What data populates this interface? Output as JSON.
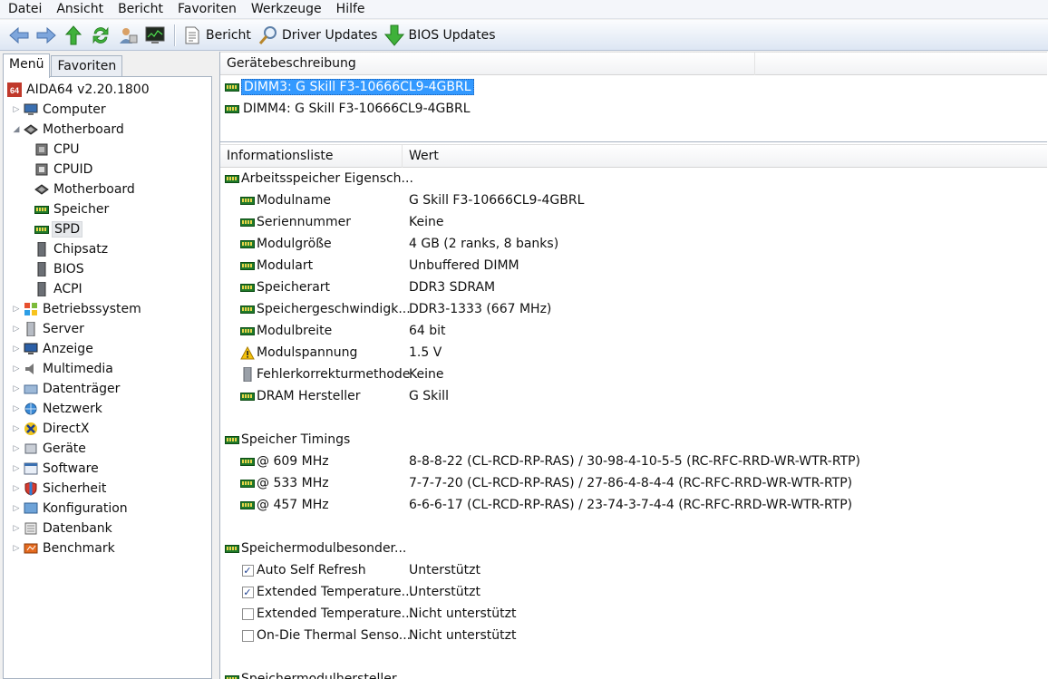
{
  "menu": [
    "Datei",
    "Ansicht",
    "Bericht",
    "Favoriten",
    "Werkzeuge",
    "Hilfe"
  ],
  "toolbar": {
    "report_label": "Bericht",
    "driver_updates_label": "Driver Updates",
    "bios_updates_label": "BIOS Updates"
  },
  "left": {
    "tab_menu": "Menü",
    "tab_favorites": "Favoriten",
    "root": "AIDA64 v2.20.1800",
    "tree": [
      {
        "label": "Computer",
        "level": 1,
        "expander": "collapsed",
        "icon": "computer-icon"
      },
      {
        "label": "Motherboard",
        "level": 1,
        "expander": "expanded",
        "icon": "motherboard-icon"
      },
      {
        "label": "CPU",
        "level": 2,
        "icon": "cpu-icon"
      },
      {
        "label": "CPUID",
        "level": 2,
        "icon": "cpuid-icon"
      },
      {
        "label": "Motherboard",
        "level": 2,
        "icon": "motherboard-icon"
      },
      {
        "label": "Speicher",
        "level": 2,
        "icon": "memory-icon"
      },
      {
        "label": "SPD",
        "level": 2,
        "icon": "spd-icon",
        "selected": true
      },
      {
        "label": "Chipsatz",
        "level": 2,
        "icon": "chipset-icon"
      },
      {
        "label": "BIOS",
        "level": 2,
        "icon": "bios-icon"
      },
      {
        "label": "ACPI",
        "level": 2,
        "icon": "acpi-icon"
      },
      {
        "label": "Betriebssystem",
        "level": 1,
        "expander": "collapsed",
        "icon": "windows-icon"
      },
      {
        "label": "Server",
        "level": 1,
        "expander": "collapsed",
        "icon": "server-icon"
      },
      {
        "label": "Anzeige",
        "level": 1,
        "expander": "collapsed",
        "icon": "display-icon"
      },
      {
        "label": "Multimedia",
        "level": 1,
        "expander": "collapsed",
        "icon": "speaker-icon"
      },
      {
        "label": "Datenträger",
        "level": 1,
        "expander": "collapsed",
        "icon": "storage-icon"
      },
      {
        "label": "Netzwerk",
        "level": 1,
        "expander": "collapsed",
        "icon": "network-icon"
      },
      {
        "label": "DirectX",
        "level": 1,
        "expander": "collapsed",
        "icon": "directx-icon"
      },
      {
        "label": "Geräte",
        "level": 1,
        "expander": "collapsed",
        "icon": "devices-icon"
      },
      {
        "label": "Software",
        "level": 1,
        "expander": "collapsed",
        "icon": "software-icon"
      },
      {
        "label": "Sicherheit",
        "level": 1,
        "expander": "collapsed",
        "icon": "shield-icon"
      },
      {
        "label": "Konfiguration",
        "level": 1,
        "expander": "collapsed",
        "icon": "config-icon"
      },
      {
        "label": "Datenbank",
        "level": 1,
        "expander": "collapsed",
        "icon": "database-icon"
      },
      {
        "label": "Benchmark",
        "level": 1,
        "expander": "collapsed",
        "icon": "benchmark-icon"
      }
    ]
  },
  "devices": {
    "header": "Gerätebeschreibung",
    "items": [
      {
        "label": "DIMM3: G Skill F3-10666CL9-4GBRL",
        "selected": true
      },
      {
        "label": "DIMM4: G Skill F3-10666CL9-4GBRL",
        "selected": false
      }
    ]
  },
  "info": {
    "col_name": "Informationsliste",
    "col_value": "Wert",
    "rows": [
      {
        "type": "group",
        "name": "Arbeitsspeicher Eigensch...",
        "icon": "ram-icon"
      },
      {
        "type": "item",
        "name": "Modulname",
        "value": "G Skill F3-10666CL9-4GBRL",
        "icon": "ram-icon"
      },
      {
        "type": "item",
        "name": "Seriennummer",
        "value": "Keine",
        "icon": "ram-icon"
      },
      {
        "type": "item",
        "name": "Modulgröße",
        "value": "4 GB (2 ranks, 8 banks)",
        "icon": "ram-icon"
      },
      {
        "type": "item",
        "name": "Modulart",
        "value": "Unbuffered DIMM",
        "icon": "ram-icon"
      },
      {
        "type": "item",
        "name": "Speicherart",
        "value": "DDR3 SDRAM",
        "icon": "ram-icon"
      },
      {
        "type": "item",
        "name": "Speichergeschwindigk...",
        "value": "DDR3-1333 (667 MHz)",
        "icon": "ram-icon"
      },
      {
        "type": "item",
        "name": "Modulbreite",
        "value": "64 bit",
        "icon": "ram-icon"
      },
      {
        "type": "item",
        "name": "Modulspannung",
        "value": "1.5 V",
        "icon": "warning-icon"
      },
      {
        "type": "item",
        "name": "Fehlerkorrekturmethode",
        "value": "Keine",
        "icon": "chip-icon"
      },
      {
        "type": "item",
        "name": "DRAM Hersteller",
        "value": "G Skill",
        "icon": "ram-icon"
      },
      {
        "type": "blank"
      },
      {
        "type": "group",
        "name": "Speicher Timings",
        "icon": "ram-icon"
      },
      {
        "type": "item",
        "name": "@ 609 MHz",
        "value": "8-8-8-22  (CL-RCD-RP-RAS) / 30-98-4-10-5-5  (RC-RFC-RRD-WR-WTR-RTP)",
        "icon": "ram-icon"
      },
      {
        "type": "item",
        "name": "@ 533 MHz",
        "value": "7-7-7-20  (CL-RCD-RP-RAS) / 27-86-4-8-4-4  (RC-RFC-RRD-WR-WTR-RTP)",
        "icon": "ram-icon"
      },
      {
        "type": "item",
        "name": "@ 457 MHz",
        "value": "6-6-6-17  (CL-RCD-RP-RAS) / 23-74-3-7-4-4  (RC-RFC-RRD-WR-WTR-RTP)",
        "icon": "ram-icon"
      },
      {
        "type": "blank"
      },
      {
        "type": "group",
        "name": "Speichermodulbesonder...",
        "icon": "ram-icon"
      },
      {
        "type": "item",
        "name": "Auto Self Refresh",
        "value": "Unterstützt",
        "icon": "checkbox-checked"
      },
      {
        "type": "item",
        "name": "Extended Temperature...",
        "value": "Unterstützt",
        "icon": "checkbox-checked"
      },
      {
        "type": "item",
        "name": "Extended Temperature...",
        "value": "Nicht unterstützt",
        "icon": "checkbox-unchecked"
      },
      {
        "type": "item",
        "name": "On-Die Thermal Senso...",
        "value": "Nicht unterstützt",
        "icon": "checkbox-unchecked"
      },
      {
        "type": "blank"
      },
      {
        "type": "group",
        "name": "Speichermodulhersteller",
        "icon": "ram-icon"
      }
    ]
  }
}
